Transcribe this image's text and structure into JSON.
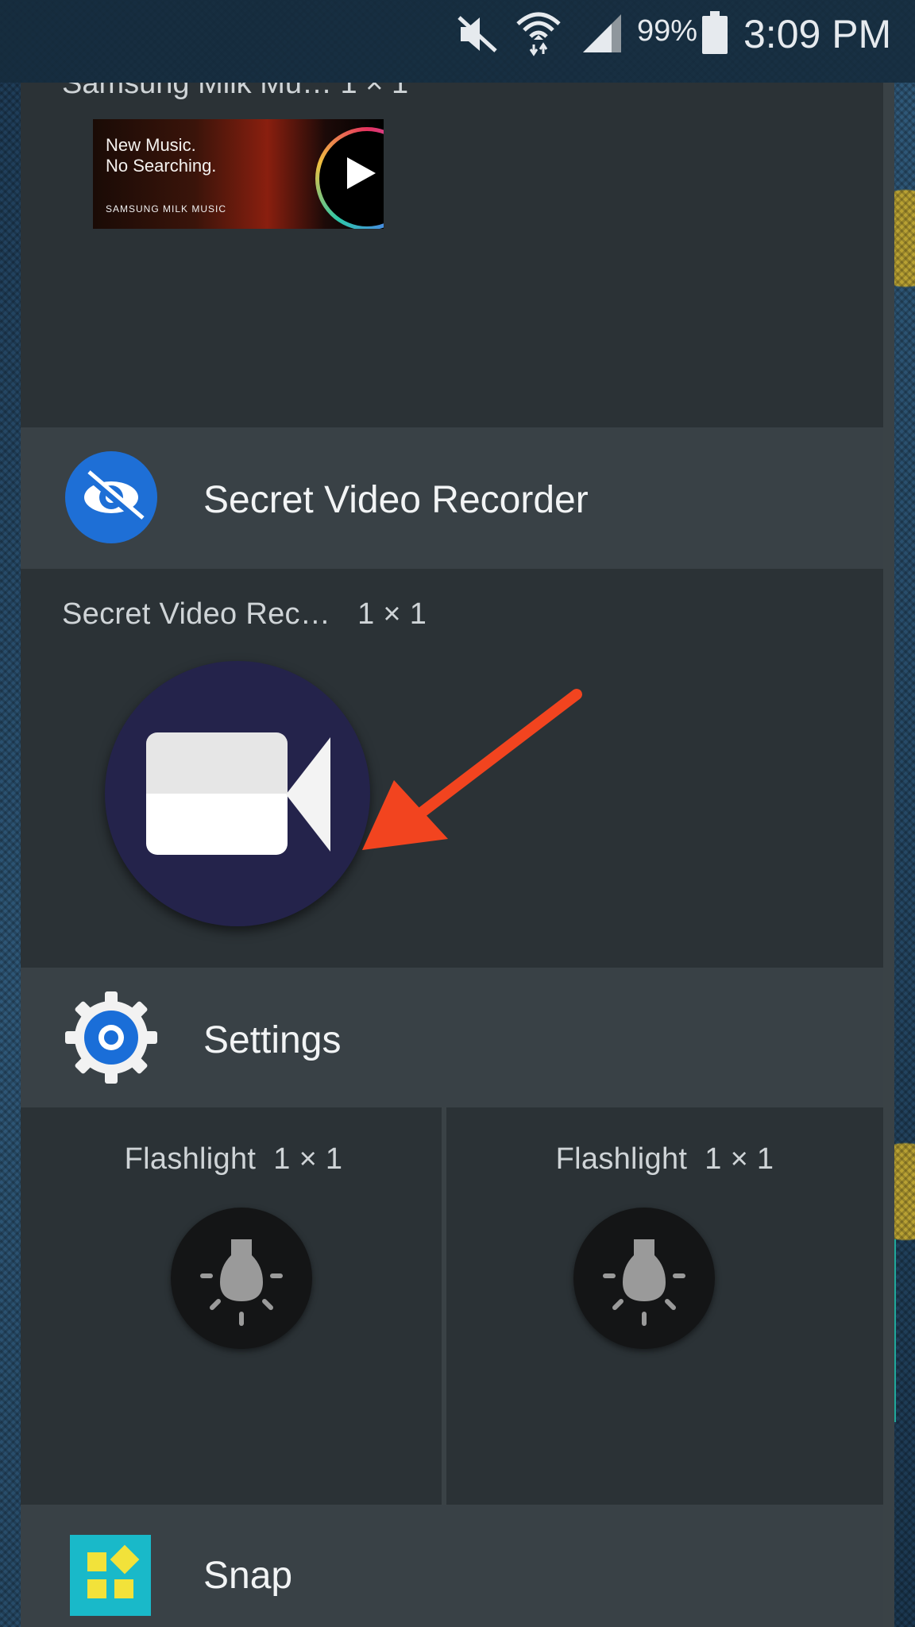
{
  "status_bar": {
    "battery_percent": "99%",
    "time": "3:09 PM",
    "icons": [
      "mute-icon",
      "wifi-icon",
      "signal-icon",
      "battery-icon"
    ]
  },
  "previous_widget": {
    "caption": "Samsung Milk Mu…   1 × 1",
    "thumbnail_text_line1": "New Music.",
    "thumbnail_text_line2": "No Searching.",
    "thumbnail_brand": "SAMSUNG MILK MUSIC"
  },
  "apps": [
    {
      "name": "Secret Video Recorder",
      "icon": "eye-slash-icon",
      "widget_caption": "Secret Video Rec…",
      "widget_size": "1 × 1",
      "widget_icon": "video-camera-icon"
    },
    {
      "name": "Settings",
      "icon": "gear-icon",
      "widgets": [
        {
          "caption": "Flashlight",
          "size": "1 × 1",
          "icon": "lightbulb-icon"
        },
        {
          "caption": "Flashlight",
          "size": "1 × 1",
          "icon": "lightbulb-icon"
        }
      ]
    },
    {
      "name": "Snap",
      "icon": "snap-grid-icon"
    }
  ],
  "colors": {
    "annotation_arrow": "#f2441f",
    "video_widget_bg": "#24234b",
    "settings_blue": "#1a6ed8"
  }
}
